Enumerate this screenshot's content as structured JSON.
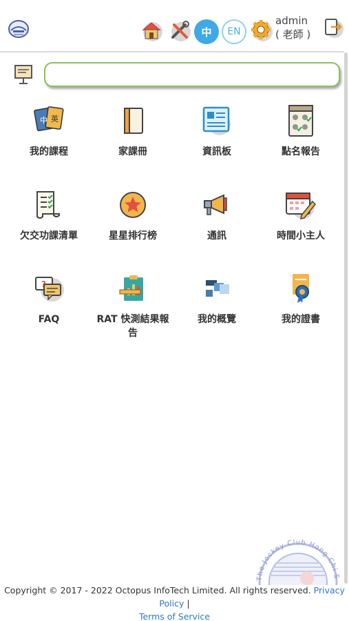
{
  "header": {
    "user_name": "admin",
    "user_role": "( 老師 )",
    "lang_zh": "中",
    "lang_en": "EN"
  },
  "search": {
    "placeholder": "",
    "value": ""
  },
  "tiles": [
    {
      "label": "我的課程",
      "icon": "book-cards-icon"
    },
    {
      "label": "家課冊",
      "icon": "homework-book-icon"
    },
    {
      "label": "資訊板",
      "icon": "news-board-icon"
    },
    {
      "label": "點名報告",
      "icon": "attendance-icon"
    },
    {
      "label": "欠交功課清單",
      "icon": "checklist-icon"
    },
    {
      "label": "星星排行榜",
      "icon": "star-icon"
    },
    {
      "label": "通訊",
      "icon": "megaphone-icon"
    },
    {
      "label": "時間小主人",
      "icon": "calendar-icon"
    },
    {
      "label": "FAQ",
      "icon": "faq-icon"
    },
    {
      "label": "RAT 快測結果報告",
      "icon": "clipboard-chart-icon"
    },
    {
      "label": "我的概覽",
      "icon": "overview-icon"
    },
    {
      "label": "我的證書",
      "icon": "certificate-icon"
    }
  ],
  "stamp_text": "The Jockey Club Hong Chi School",
  "footer": {
    "copyright": "Copyright © 2017 - 2022 Octopus InfoTech Limited. All rights reserved.",
    "privacy": "Privacy Policy",
    "separator": " |",
    "terms": "Terms of Service"
  },
  "colors": {
    "accent_blue": "#3fa9e8",
    "search_border": "#8cc152",
    "link": "#2f78c4"
  }
}
